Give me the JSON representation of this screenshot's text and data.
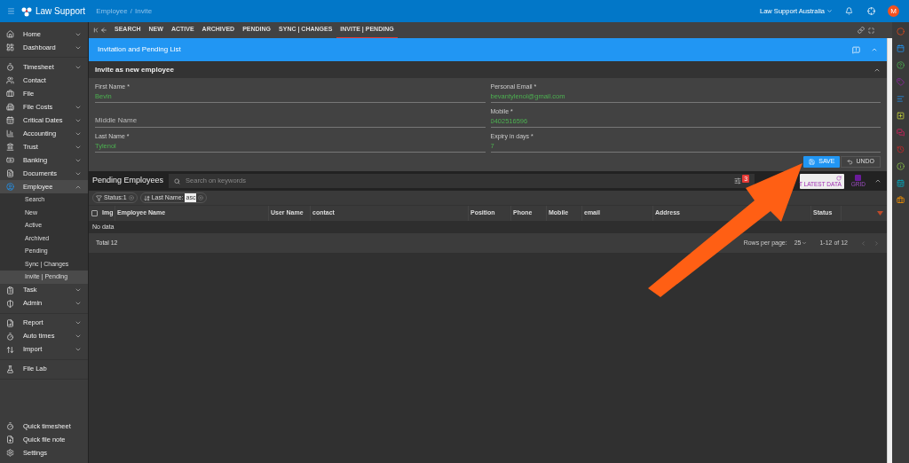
{
  "topbar": {
    "brand": "Law Support",
    "breadcrumb": [
      "Employee",
      "Invite"
    ],
    "breadcrumb_separator": "/",
    "account": "Law Support Australia",
    "avatar": "M"
  },
  "sidebar": {
    "groups": [
      {
        "items": [
          {
            "label": "Home",
            "expanded": false
          },
          {
            "label": "Dashboard",
            "expanded": false
          }
        ]
      },
      {
        "items": [
          {
            "label": "Timesheet",
            "expanded": false
          },
          {
            "label": "Contact"
          },
          {
            "label": "File"
          },
          {
            "label": "File Costs",
            "expanded": false
          },
          {
            "label": "Critical Dates",
            "expanded": false
          },
          {
            "label": "Accounting",
            "expanded": false
          },
          {
            "label": "Trust",
            "expanded": false
          },
          {
            "label": "Banking",
            "expanded": false
          },
          {
            "label": "Documents",
            "expanded": false
          },
          {
            "label": "Employee",
            "expanded": true,
            "selected": true,
            "children": [
              {
                "label": "Search",
                "selected": false
              },
              {
                "label": "New",
                "selected": false
              },
              {
                "label": "Active",
                "selected": false
              },
              {
                "label": "Archived",
                "selected": false
              },
              {
                "label": "Pending",
                "selected": false
              },
              {
                "label": "Sync | Changes",
                "selected": false
              },
              {
                "label": "Invite | Pending",
                "selected": true
              }
            ]
          },
          {
            "label": "Task",
            "expanded": false
          },
          {
            "label": "Admin",
            "expanded": false
          }
        ]
      },
      {
        "items": [
          {
            "label": "Report",
            "expanded": false
          },
          {
            "label": "Auto times",
            "expanded": false
          },
          {
            "label": "Import",
            "expanded": false
          }
        ]
      },
      {
        "items": [
          {
            "label": "File Lab"
          }
        ]
      }
    ],
    "bottom": [
      {
        "label": "Quick timesheet"
      },
      {
        "label": "Quick file note"
      },
      {
        "label": "Settings"
      }
    ]
  },
  "tabs": [
    {
      "label": "SEARCH",
      "selected": false
    },
    {
      "label": "NEW",
      "selected": false
    },
    {
      "label": "ACTIVE",
      "selected": false
    },
    {
      "label": "ARCHIVED",
      "selected": false
    },
    {
      "label": "PENDING",
      "selected": false
    },
    {
      "label": "SYNC | CHANGES",
      "selected": false
    },
    {
      "label": "INVITE | PENDING",
      "selected": true
    }
  ],
  "panel": {
    "title": "Invitation and Pending List"
  },
  "invite": {
    "title": "Invite as new employee",
    "left": [
      {
        "label": "First Name *",
        "value": "Bevin"
      },
      {
        "placeholder": "Middle Name"
      },
      {
        "label": "Last Name *",
        "value": "Tylenol"
      }
    ],
    "right": [
      {
        "label": "Personal Email *",
        "value": "bevantylenol@gmail.com"
      },
      {
        "label": "Mobile *",
        "value": "0402516596"
      },
      {
        "label": "Expiry in days *",
        "value": "7"
      }
    ],
    "save": "SAVE",
    "undo": "UNDO"
  },
  "pending": {
    "title": "Pending Employees",
    "search_placeholder": "Search on keywords",
    "filter_badge": "3",
    "latest": "T LATEST DATA",
    "grid": "GRID",
    "select_all_checked": false,
    "chips": [
      {
        "kind": "filter",
        "label": "Status:1"
      },
      {
        "kind": "sort",
        "label": "Last Name:",
        "value": "asc"
      }
    ],
    "columns": [
      "Img",
      "Employee Name",
      "User Name",
      "contact",
      "Position",
      "Phone",
      "Mobile",
      "email",
      "Address",
      "Status"
    ],
    "empty": "No data",
    "total": "Total 12",
    "rows_per_page_label": "Rows per page:",
    "rows_per_page": "25",
    "range": "1-12 of 12"
  }
}
